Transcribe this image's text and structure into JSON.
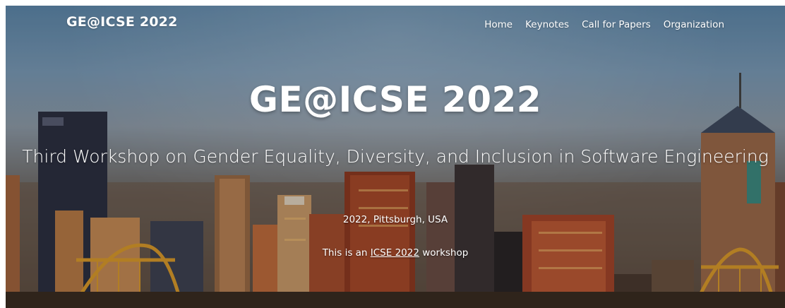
{
  "nav": {
    "brand": "GE@ICSE 2022",
    "items": [
      {
        "label": "Home"
      },
      {
        "label": "Keynotes"
      },
      {
        "label": "Call for Papers"
      },
      {
        "label": "Organization"
      }
    ]
  },
  "hero": {
    "title": "GE@ICSE 2022",
    "subtitle": "Third Workshop on Gender Equality, Diversity, and Inclusion in Software Engineering",
    "location": "2022, Pittsburgh, USA",
    "note_prefix": "This is an ",
    "note_link": "ICSE 2022",
    "note_suffix": " workshop"
  },
  "colors": {
    "text": "#ffffff",
    "sky_top": "#5d87aa",
    "building_dark": "#2b2e3a",
    "building_brick": "#8a4a2c",
    "bridge": "#d99a2b"
  }
}
